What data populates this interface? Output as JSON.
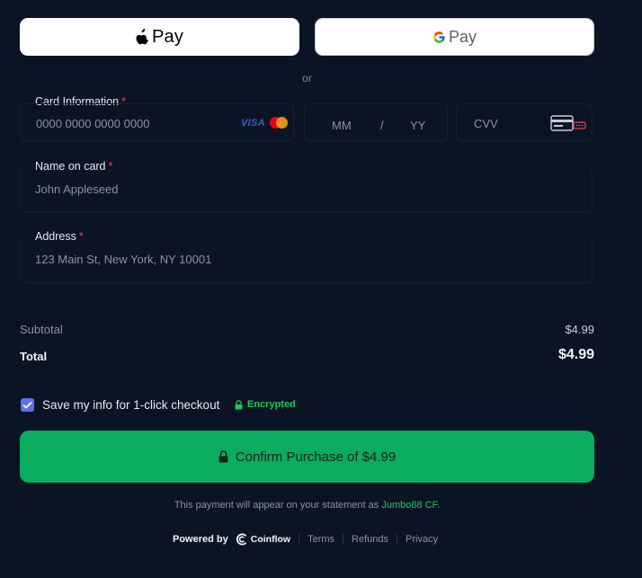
{
  "wallets": {
    "apple_label": "Pay",
    "google_label": "Pay"
  },
  "divider_text": "or",
  "card": {
    "label": "Card Information",
    "required": "*",
    "number_placeholder": "0000 0000 0000 0000",
    "visa": "VISA",
    "month_placeholder": "MM",
    "slash": "/",
    "year_placeholder": "YY",
    "cvv_placeholder": "CVV"
  },
  "name": {
    "label": "Name on card",
    "required": "*",
    "value": "John Appleseed"
  },
  "address": {
    "label": "Address",
    "required": "*",
    "value": "123 Main St, New York, NY 10001"
  },
  "summary": {
    "subtotal_label": "Subtotal",
    "subtotal_value": "$4.99",
    "total_label": "Total",
    "total_value": "$4.99"
  },
  "save": {
    "label": "Save my info for 1-click checkout",
    "checked": true,
    "encrypted": "Encrypted"
  },
  "confirm": {
    "label": "Confirm Purchase of $4.99"
  },
  "statement": {
    "prefix": "This payment will appear on your statement as",
    "merchant": "Jumbo88 CF",
    "suffix": "."
  },
  "footer": {
    "powered_by": "Powered by",
    "brand": "Coinflow",
    "links": [
      "Terms",
      "Refunds",
      "Privacy"
    ]
  },
  "colors": {
    "background": "#0b1424",
    "accent_green": "#0aad5e",
    "checkbox_blue": "#5a73e8",
    "required_red": "#e5484d",
    "encrypted_green": "#22c55e"
  }
}
